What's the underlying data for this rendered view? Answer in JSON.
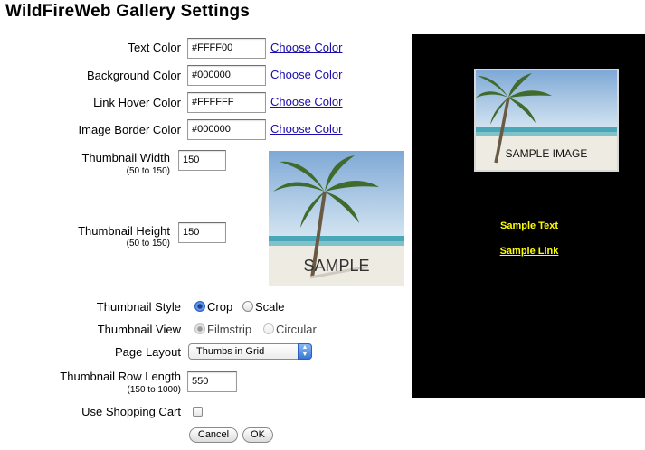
{
  "page": {
    "title": "WildFireWeb Gallery Settings"
  },
  "fields": {
    "text_color": {
      "label": "Text Color",
      "value": "#FFFF00",
      "link": "Choose Color"
    },
    "background_color": {
      "label": "Background Color",
      "value": "#000000",
      "link": "Choose Color"
    },
    "link_hover_color": {
      "label": "Link Hover Color",
      "value": "#FFFFFF",
      "link": "Choose Color"
    },
    "image_border_color": {
      "label": "Image Border Color",
      "value": "#000000",
      "link": "Choose Color"
    },
    "thumbnail_width": {
      "label": "Thumbnail Width",
      "range": "(50 to 150)",
      "value": "150"
    },
    "thumbnail_height": {
      "label": "Thumbnail Height",
      "range": "(50 to 150)",
      "value": "150"
    },
    "thumbnail_style": {
      "label": "Thumbnail Style",
      "options": [
        "Crop",
        "Scale"
      ],
      "selected": "Crop"
    },
    "thumbnail_view": {
      "label": "Thumbnail View",
      "options": [
        "Filmstrip",
        "Circular"
      ],
      "selected": "Filmstrip",
      "disabled": true
    },
    "page_layout": {
      "label": "Page Layout",
      "value": "Thumbs in Grid"
    },
    "row_length": {
      "label": "Thumbnail Row Length",
      "range": "(150 to 1000)",
      "value": "550"
    },
    "shopping_cart": {
      "label": "Use Shopping Cart",
      "checked": false
    }
  },
  "sample_image": {
    "caption": "SAMPLE"
  },
  "preview": {
    "image_caption": "SAMPLE IMAGE",
    "sample_text": "Sample Text",
    "sample_link": "Sample Link",
    "text_color": "#FFFF00",
    "background_color": "#000000"
  },
  "buttons": {
    "cancel": "Cancel",
    "ok": "OK"
  },
  "icons": {
    "select_arrow": "up-down-chevron-icon"
  }
}
